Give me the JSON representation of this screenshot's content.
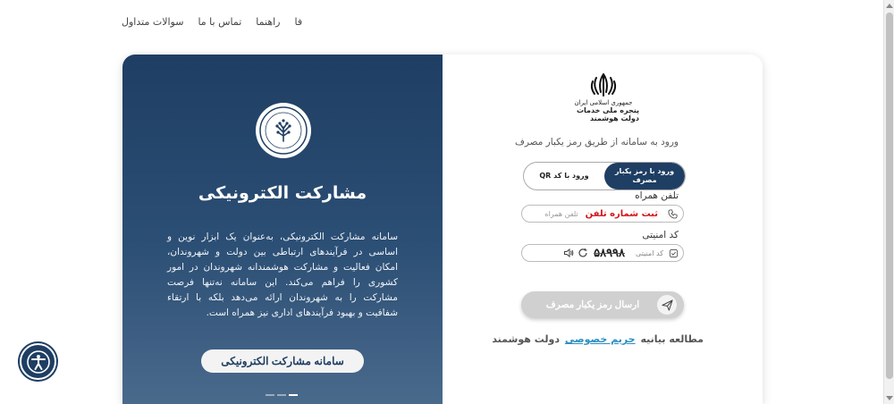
{
  "topnav": {
    "faq": "سوالات متداول",
    "contact": "تماس با ما",
    "guide": "راهنما",
    "lang": "فا"
  },
  "left": {
    "title": "مشارکت الکترونیکی",
    "description": "سامانه مشارکت الکترونیکی، به‌عنوان یک ابزار نوین و اساسی در فرآیندهای ارتباطی بین دولت و شهروندان، امکان فعالیت و مشارکت هوشمندانه شهروندان در امور کشوری را فراهم می‌کند. این سامانه نه‌تنها فرصت مشارکت را به شهروندان ارائه می‌دهد بلکه با ارتقاء شفافیت و بهبود فرآیندهای اداری نیز همراه است.",
    "button": "سامانه مشارکت الکترونیکی",
    "slide_count": 3,
    "active_slide": 3
  },
  "right": {
    "logo_line1": "جمهوری اسلامی ایران",
    "logo_line2": "پنجره ملی خدمات دولت هوشمند",
    "subtitle": "ورود به سامانه از طریق رمز یکبار مصرف",
    "tab_otp": "ورود با رمز یکبار مصرف",
    "tab_qr": "ورود با کد QR",
    "phone_label": "تلفن همراه",
    "phone_placeholder": "تلفن همراه",
    "phone_hint": "ثبت شماره تلفن",
    "captcha_label": "کد امنیتی",
    "captcha_placeholder": "کد امنیتی",
    "captcha_code": "۵۸۹۹۸",
    "send_button": "ارسال رمز یکبار مصرف",
    "privacy_prefix": "مطالعه بیانیه",
    "privacy_link": "حریم خصوصی",
    "privacy_suffix": "دولت هوشمند"
  },
  "colors": {
    "primary": "#1f3e63",
    "hint_red": "#d4141a",
    "link_blue": "#2b8ec2",
    "disabled_btn": "#d0d0d0"
  }
}
